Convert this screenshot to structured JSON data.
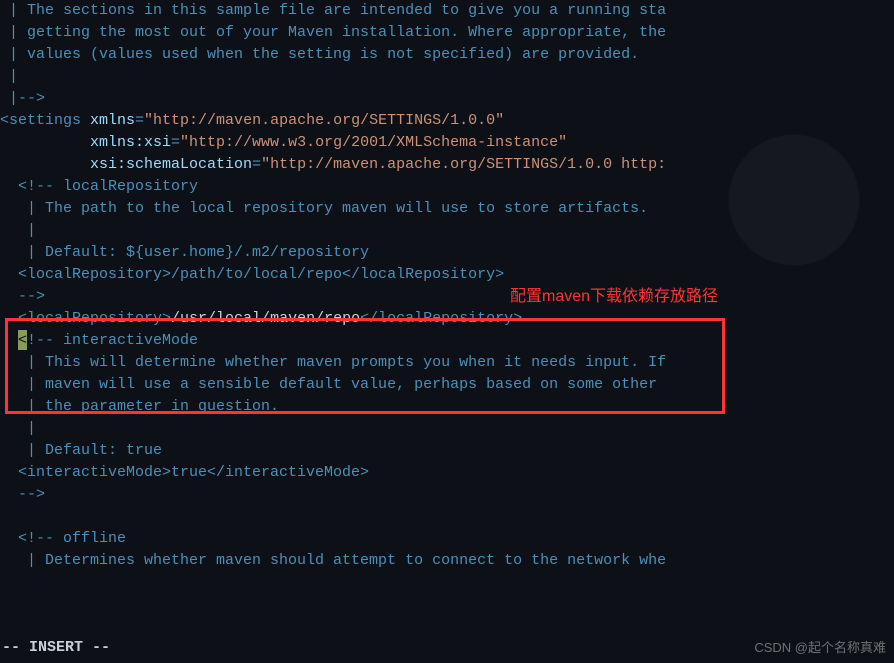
{
  "lines": [
    {
      "segments": [
        {
          "t": " | The sections in this sample file are intended to give you a running sta",
          "c": "comment"
        }
      ]
    },
    {
      "segments": [
        {
          "t": " | getting the most out of your Maven installation. Where appropriate, the",
          "c": "comment"
        }
      ]
    },
    {
      "segments": [
        {
          "t": " | values (values used when the setting is not specified) are provided.",
          "c": "comment"
        }
      ]
    },
    {
      "segments": [
        {
          "t": " |",
          "c": "comment"
        }
      ]
    },
    {
      "segments": [
        {
          "t": " |-->",
          "c": "comment"
        }
      ]
    },
    {
      "segments": [
        {
          "t": "<settings ",
          "c": "tag"
        },
        {
          "t": "xmlns",
          "c": "attr"
        },
        {
          "t": "=",
          "c": "tag"
        },
        {
          "t": "\"http://maven.apache.org/SETTINGS/1.0.0\"",
          "c": "string"
        }
      ]
    },
    {
      "segments": [
        {
          "t": "          ",
          "c": "normal"
        },
        {
          "t": "xmlns:xsi",
          "c": "attr"
        },
        {
          "t": "=",
          "c": "tag"
        },
        {
          "t": "\"http://www.w3.org/2001/XMLSchema-instance\"",
          "c": "string"
        }
      ]
    },
    {
      "segments": [
        {
          "t": "          ",
          "c": "normal"
        },
        {
          "t": "xsi:schemaLocation",
          "c": "attr"
        },
        {
          "t": "=",
          "c": "tag"
        },
        {
          "t": "\"http://maven.apache.org/SETTINGS/1.0.0 http:",
          "c": "string"
        }
      ]
    },
    {
      "segments": [
        {
          "t": "  <!-- localRepository",
          "c": "comment"
        }
      ]
    },
    {
      "segments": [
        {
          "t": "   | The path to the local repository maven will use to store artifacts.",
          "c": "comment"
        }
      ]
    },
    {
      "segments": [
        {
          "t": "   |",
          "c": "comment"
        }
      ]
    },
    {
      "segments": [
        {
          "t": "   | Default: ${user.home}/.m2/repository",
          "c": "comment"
        }
      ]
    },
    {
      "segments": [
        {
          "t": "  <localRepository>/path/to/local/repo</localRepository>",
          "c": "comment"
        }
      ]
    },
    {
      "segments": [
        {
          "t": "  -->",
          "c": "comment"
        }
      ]
    },
    {
      "segments": [
        {
          "t": "  ",
          "c": "normal"
        },
        {
          "t": "<localRepository>",
          "c": "tag"
        },
        {
          "t": "/usr/local/maven/repo",
          "c": "normal"
        },
        {
          "t": "</localRepository>",
          "c": "tag"
        }
      ]
    },
    {
      "cursor": true,
      "segments": [
        {
          "t": "!-- interactiveMode",
          "c": "comment"
        }
      ]
    },
    {
      "segments": [
        {
          "t": "   | This will determine whether maven prompts you when it needs input. If",
          "c": "comment"
        }
      ]
    },
    {
      "segments": [
        {
          "t": "   | maven will use a sensible default value, perhaps based on some other ",
          "c": "comment"
        }
      ]
    },
    {
      "segments": [
        {
          "t": "   | the parameter in question.",
          "c": "comment"
        }
      ]
    },
    {
      "segments": [
        {
          "t": "   |",
          "c": "comment"
        }
      ]
    },
    {
      "segments": [
        {
          "t": "   | Default: true",
          "c": "comment"
        }
      ]
    },
    {
      "segments": [
        {
          "t": "  <interactiveMode>true</interactiveMode>",
          "c": "comment"
        }
      ]
    },
    {
      "segments": [
        {
          "t": "  -->",
          "c": "comment"
        }
      ]
    },
    {
      "segments": [
        {
          "t": "",
          "c": "comment"
        }
      ]
    },
    {
      "segments": [
        {
          "t": "  <!-- offline",
          "c": "comment"
        }
      ]
    },
    {
      "segments": [
        {
          "t": "   | Determines whether maven should attempt to connect to the network whe",
          "c": "comment"
        }
      ]
    }
  ],
  "annotation": "配置maven下载依赖存放路径",
  "status": "-- INSERT --",
  "watermark": "CSDN @起个名称真难"
}
